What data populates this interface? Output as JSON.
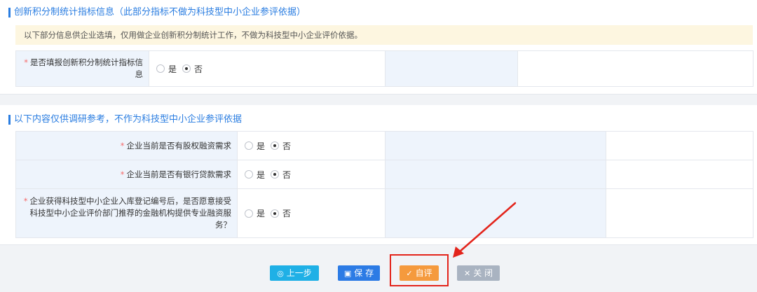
{
  "section1": {
    "title": "创新积分制统计指标信息（此部分指标不做为科技型中小企业参评依据）",
    "notice": "以下部分信息供企业选填，仅用做企业创新积分制统计工作，不做为科技型中小企业评价依据。",
    "rows": [
      {
        "required_mark": "*",
        "label": "是否填报创新积分制统计指标信息",
        "options": [
          {
            "text": "是",
            "checked": false
          },
          {
            "text": "否",
            "checked": true
          }
        ]
      }
    ]
  },
  "section2": {
    "title": "以下内容仅供调研参考，不作为科技型中小企业参评依据",
    "rows": [
      {
        "required_mark": "*",
        "label": "企业当前是否有股权融资需求",
        "options": [
          {
            "text": "是",
            "checked": false
          },
          {
            "text": "否",
            "checked": true
          }
        ]
      },
      {
        "required_mark": "*",
        "label": "企业当前是否有银行贷款需求",
        "options": [
          {
            "text": "是",
            "checked": false
          },
          {
            "text": "否",
            "checked": true
          }
        ]
      },
      {
        "required_mark": "*",
        "label": "企业获得科技型中小企业入库登记编号后，是否愿意接受科技型中小企业评价部门推荐的金融机构提供专业融资服务？",
        "options": [
          {
            "text": "是",
            "checked": false
          },
          {
            "text": "否",
            "checked": true
          }
        ]
      }
    ]
  },
  "buttons": {
    "prev": {
      "label": "上一步",
      "icon": "circle-dot-icon"
    },
    "save": {
      "label": "保 存",
      "icon": "floppy-icon"
    },
    "eval": {
      "label": "自评",
      "icon": "check-circle-icon"
    },
    "close": {
      "label": "关 闭",
      "icon": "close-icon"
    }
  },
  "colors": {
    "accent": "#2a7de1",
    "label_bg": "#eef4fc",
    "notice_bg": "#fdf6e0",
    "required": "#f56c6c",
    "prev_button": "#1fb0e6",
    "save_button": "#2c7be5",
    "eval_button": "#f59a3d",
    "close_button": "#a9b3c1",
    "annotation": "#e3241b"
  }
}
